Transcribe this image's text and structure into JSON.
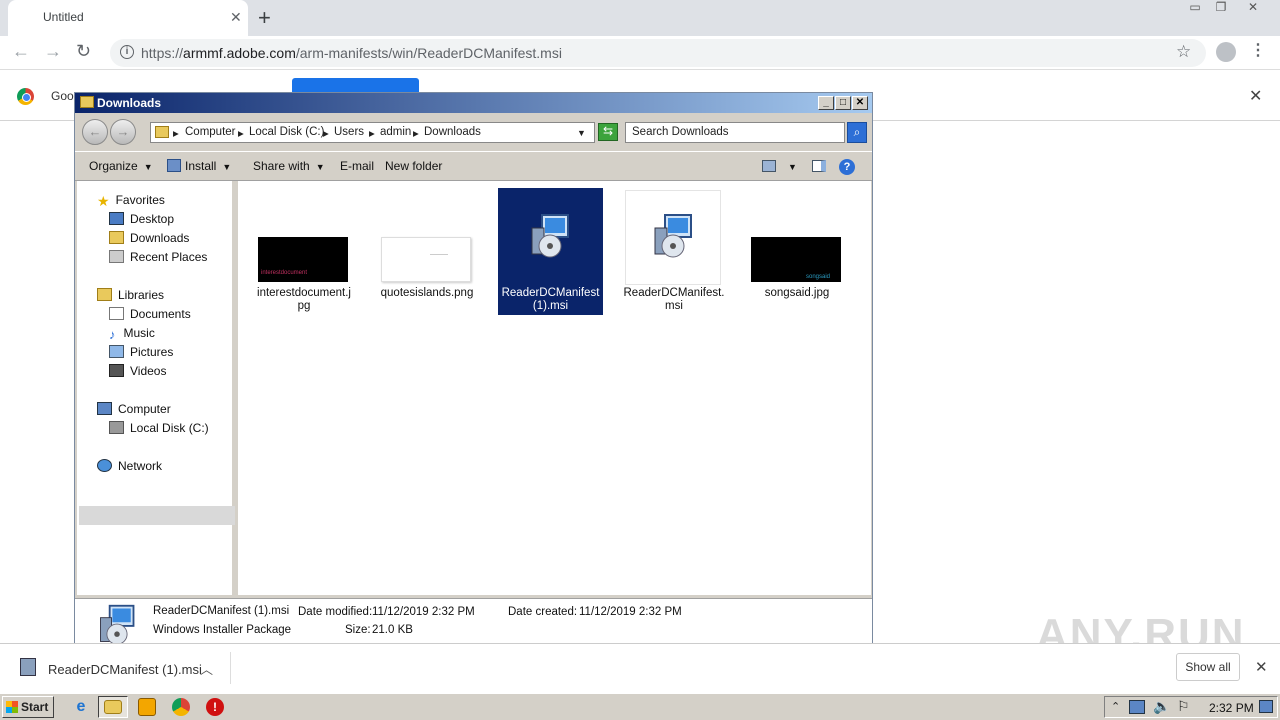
{
  "browser": {
    "tab_title": "Untitled",
    "url_host": "armmf.adobe.com",
    "url_prefix": "https://",
    "url_path": "/arm-manifests/win/ReaderDCManifest.msi",
    "infobar_text": "Goo"
  },
  "explorer": {
    "title": "Downloads",
    "breadcrumb": [
      "Computer",
      "Local Disk (C:)",
      "Users",
      "admin",
      "Downloads"
    ],
    "search_placeholder": "Search Downloads",
    "commands": {
      "organize": "Organize",
      "install": "Install",
      "share_with": "Share with",
      "email": "E-mail",
      "new_folder": "New folder"
    },
    "nav": {
      "favorites": "Favorites",
      "desktop": "Desktop",
      "downloads": "Downloads",
      "recent_places": "Recent Places",
      "libraries": "Libraries",
      "documents": "Documents",
      "music": "Music",
      "pictures": "Pictures",
      "videos": "Videos",
      "computer": "Computer",
      "local_disk": "Local Disk (C:)",
      "network": "Network"
    },
    "files": [
      {
        "name_line1": "interestdocument.j",
        "name_line2": "pg",
        "thumb_text": "interestdocument"
      },
      {
        "name_line1": "quotesislands.png",
        "name_line2": ""
      },
      {
        "name_line1": "ReaderDCManifest",
        "name_line2": "(1).msi"
      },
      {
        "name_line1": "ReaderDCManifest.",
        "name_line2": "msi"
      },
      {
        "name_line1": "songsaid.jpg",
        "name_line2": "",
        "thumb_text": "songsaid"
      }
    ],
    "details": {
      "name": "ReaderDCManifest (1).msi",
      "type": "Windows Installer Package",
      "modified_label": "Date modified:",
      "modified_value": "11/12/2019 2:32 PM",
      "created_label": "Date created:",
      "created_value": "11/12/2019 2:32 PM",
      "size_label": "Size:",
      "size_value": "21.0 KB"
    }
  },
  "shelf": {
    "download_name": "ReaderDCManifest (1).msi",
    "show_all": "Show all"
  },
  "watermark": "ANY.RUN",
  "taskbar": {
    "start": "Start",
    "clock": "2:32 PM"
  }
}
